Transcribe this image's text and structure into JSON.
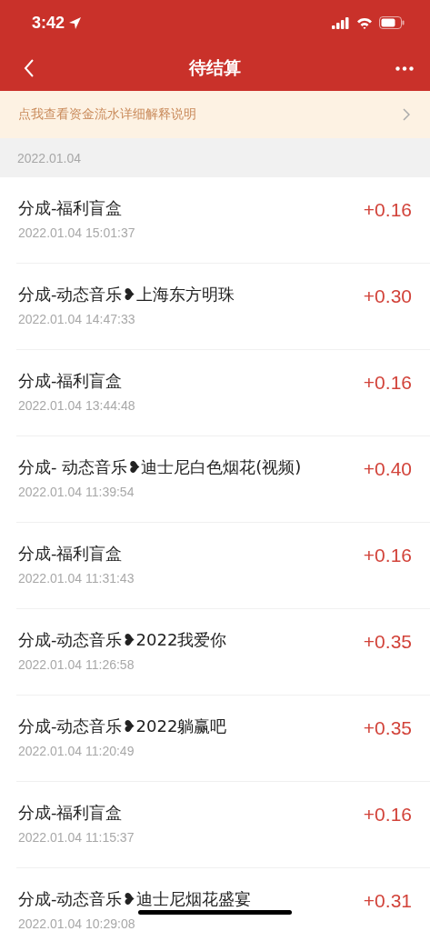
{
  "status_bar": {
    "time": "3:42"
  },
  "nav": {
    "title": "待结算"
  },
  "notice": {
    "text": "点我查看资金流水详细解释说明"
  },
  "section": {
    "date": "2022.01.04"
  },
  "records": [
    {
      "title": "分成-福利盲盒",
      "time": "2022.01.04 15:01:37",
      "amount": "+0.16"
    },
    {
      "title": "分成-动态音乐❥上海东方明珠",
      "time": "2022.01.04 14:47:33",
      "amount": "+0.30"
    },
    {
      "title": "分成-福利盲盒",
      "time": "2022.01.04 13:44:48",
      "amount": "+0.16"
    },
    {
      "title": "分成- 动态音乐❥迪士尼白色烟花(视频)",
      "time": "2022.01.04 11:39:54",
      "amount": "+0.40"
    },
    {
      "title": "分成-福利盲盒",
      "time": "2022.01.04 11:31:43",
      "amount": "+0.16"
    },
    {
      "title": "分成-动态音乐❥2022我爱你",
      "time": "2022.01.04 11:26:58",
      "amount": "+0.35"
    },
    {
      "title": "分成-动态音乐❥2022躺赢吧",
      "time": "2022.01.04 11:20:49",
      "amount": "+0.35"
    },
    {
      "title": "分成-福利盲盒",
      "time": "2022.01.04 11:15:37",
      "amount": "+0.16"
    },
    {
      "title": "分成-动态音乐❥迪士尼烟花盛宴",
      "time": "2022.01.04 10:29:08",
      "amount": "+0.31"
    }
  ]
}
